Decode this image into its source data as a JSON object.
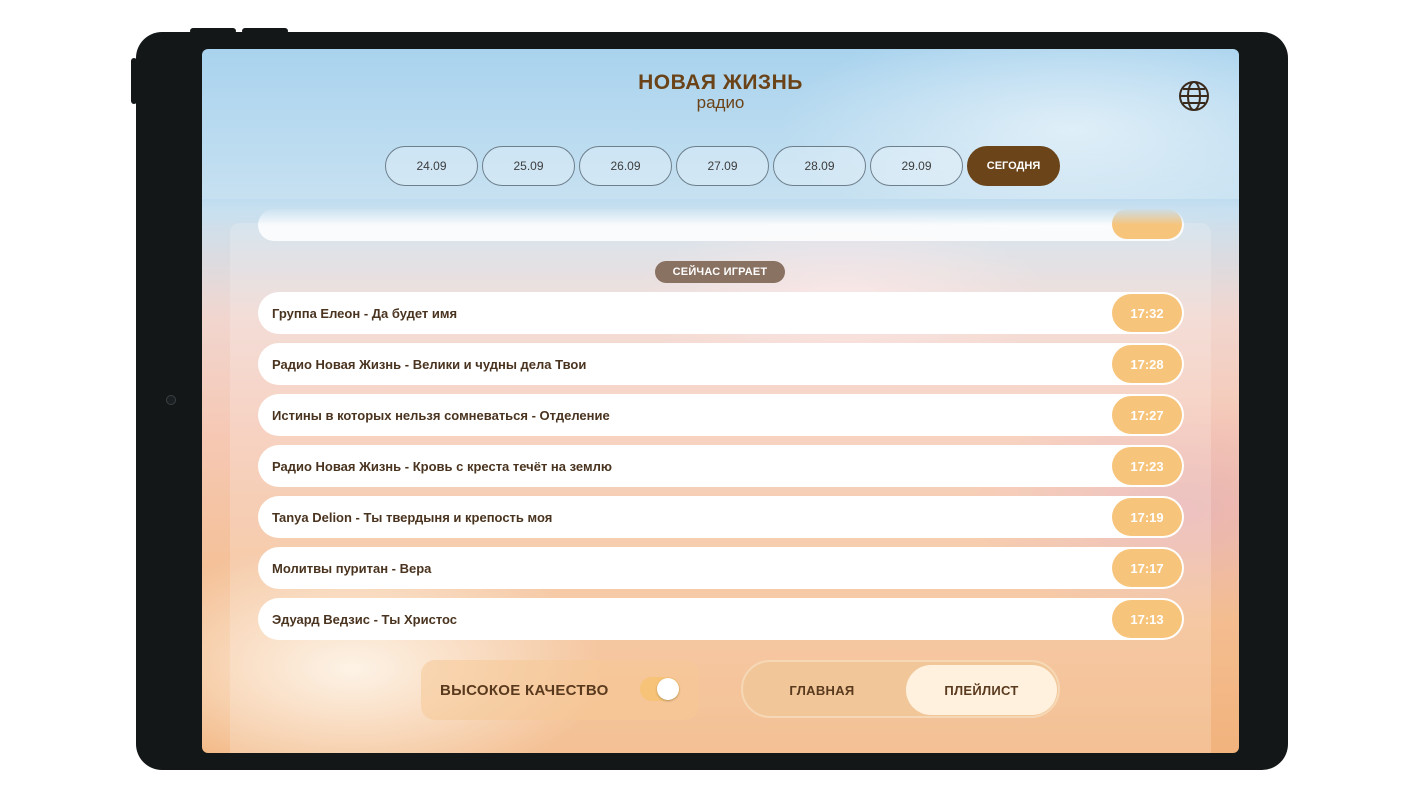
{
  "app": {
    "title": "НОВАЯ ЖИЗНЬ",
    "subtitle": "радио",
    "globe_icon": "globe-icon"
  },
  "dates": [
    {
      "label": "24.09",
      "active": false
    },
    {
      "label": "25.09",
      "active": false
    },
    {
      "label": "26.09",
      "active": false
    },
    {
      "label": "27.09",
      "active": false
    },
    {
      "label": "28.09",
      "active": false
    },
    {
      "label": "29.09",
      "active": false
    },
    {
      "label": "СЕГОДНЯ",
      "active": true
    }
  ],
  "now_playing": {
    "label": "СЕЙЧАС ИГРАЕТ"
  },
  "tracks": [
    {
      "title": "Группа Елеон - Да будет имя",
      "time": "17:32"
    },
    {
      "title": "Радио Новая Жизнь - Велики и чудны дела Твои",
      "time": "17:28"
    },
    {
      "title": "Истины в которых нельзя сомневаться - Отделение",
      "time": "17:27"
    },
    {
      "title": "Радио Новая Жизнь - Кровь с креста течёт на землю",
      "time": "17:23"
    },
    {
      "title": "Tanya Delion - Ты твердыня и крепость моя",
      "time": "17:19"
    },
    {
      "title": "Молитвы пуритан - Вера",
      "time": "17:17"
    },
    {
      "title": "Эдуард Ведзис - Ты Христос",
      "time": "17:13"
    }
  ],
  "settings": {
    "high_quality_label": "ВЫСОКОЕ КАЧЕСТВО",
    "high_quality_on": true
  },
  "nav": {
    "main_label": "ГЛАВНАЯ",
    "playlist_label": "ПЛЕЙЛИСТ",
    "active": "playlist"
  },
  "colors": {
    "brand_brown": "#6b4419",
    "time_badge": "#f7c47b",
    "now_badge": "#8a7262"
  }
}
